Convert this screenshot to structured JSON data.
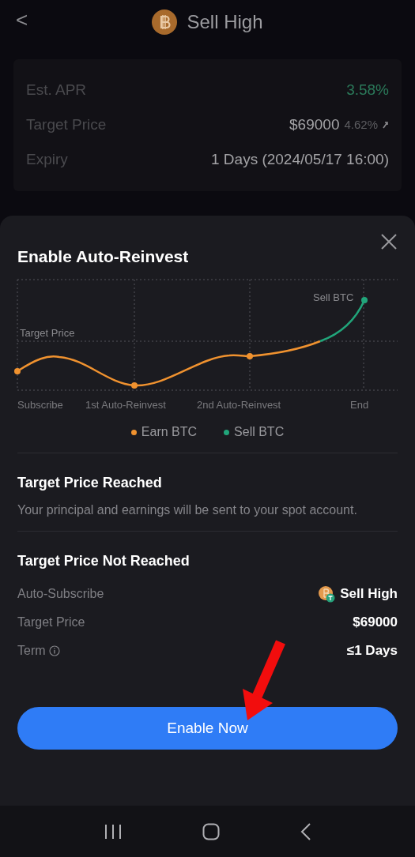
{
  "header": {
    "title": "Sell High",
    "back": "<"
  },
  "summary": [
    {
      "label": "Est. APR",
      "value": "3.58%",
      "kind": "positive"
    },
    {
      "label": "Target Price",
      "value": "$69000",
      "extra": "4.62%",
      "kind": "target"
    },
    {
      "label": "Expiry",
      "value": "1 Days (2024/05/17 16:00)",
      "kind": "plain"
    }
  ],
  "sheet": {
    "title": "Enable Auto-Reinvest",
    "chart": {
      "target_label": "Target Price",
      "end_label": "Sell BTC",
      "x_labels": [
        "Subscribe",
        "1st Auto-Reinvest",
        "2nd Auto-Reinvest",
        "End"
      ]
    },
    "legend": [
      {
        "label": "Earn BTC",
        "color": "#f0922f"
      },
      {
        "label": "Sell BTC",
        "color": "#21a57a"
      }
    ],
    "reached": {
      "title": "Target Price Reached",
      "text": "Your principal and earnings will be sent to your spot account."
    },
    "not_reached": {
      "title": "Target Price Not Reached",
      "rows": [
        {
          "label": "Auto-Subscribe",
          "value": "Sell High",
          "kind": "product"
        },
        {
          "label": "Target Price",
          "value": "$69000",
          "kind": "plain"
        },
        {
          "label": "Term",
          "value": "≤1 Days",
          "kind": "info"
        }
      ]
    },
    "button": "Enable Now"
  }
}
